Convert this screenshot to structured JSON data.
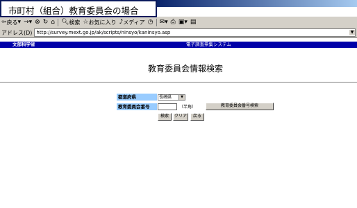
{
  "caption": "市町村（組合）教育委員会の場合",
  "toolbar": {
    "back": "戻る",
    "search": "検索",
    "favorites": "お気に入り",
    "media": "メディア"
  },
  "address": {
    "label": "アドレス(D)",
    "url": "http://survey.mext.go.jp/ak/scripts/ninsyo/kaninsyo.asp"
  },
  "header": {
    "org": "文部科学省",
    "system": "電子調査票集システム"
  },
  "page": {
    "title": "教育委員会情報検索"
  },
  "form": {
    "prefecture_label": "都道府県",
    "prefecture_value": "長崎県",
    "board_number_label": "教育委員会番号",
    "halfwidth_hint": "（半角）",
    "board_number_search_button": "教育委員会番号検索",
    "search_button": "検索",
    "clear_button": "クリア",
    "back_button": "戻る"
  }
}
